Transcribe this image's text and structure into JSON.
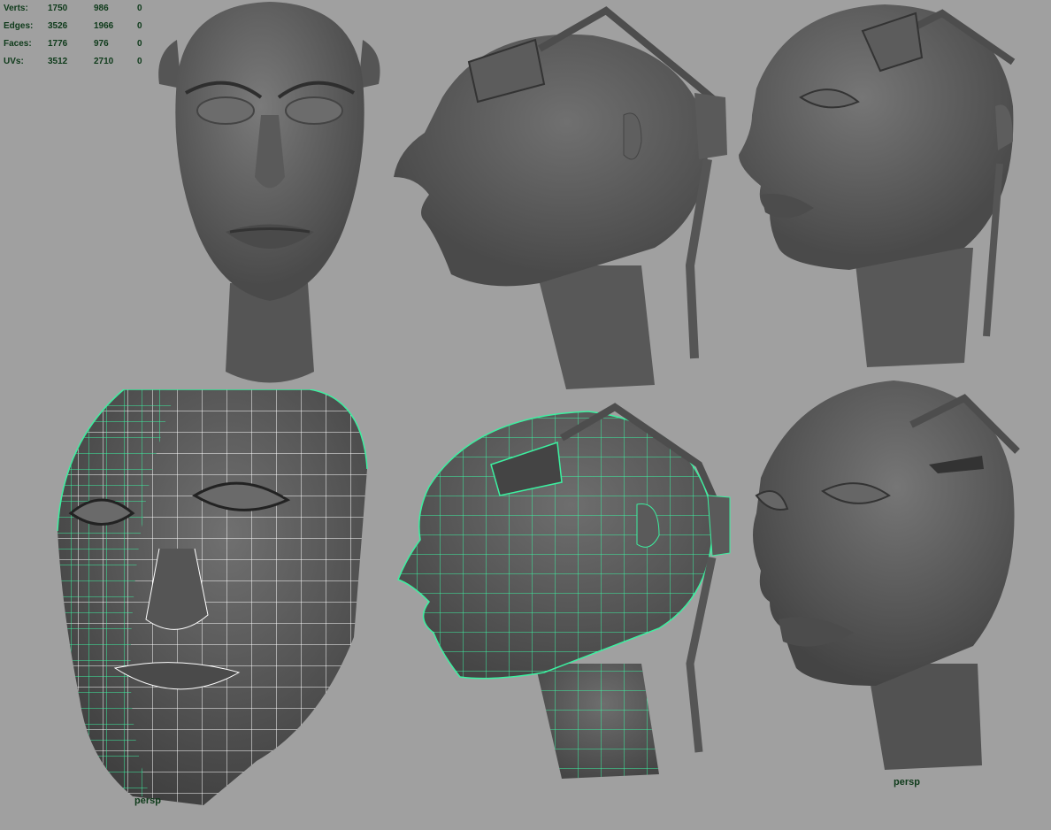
{
  "hud": {
    "rows": [
      {
        "label": "Verts:",
        "v1": "1750",
        "v2": "986",
        "v3": "0"
      },
      {
        "label": "Edges:",
        "v1": "3526",
        "v2": "1966",
        "v3": "0"
      },
      {
        "label": "Faces:",
        "v1": "1776",
        "v2": "976",
        "v3": "0"
      },
      {
        "label": "UVs:",
        "v1": "3512",
        "v2": "2710",
        "v3": "0"
      }
    ]
  },
  "cameras": {
    "left": "persp",
    "right": "persp"
  },
  "colors": {
    "background": "#a0a0a0",
    "mesh": "#5e5e5e",
    "mesh_dark": "#3c3c3c",
    "wireframe_selected": "#3cf0a0",
    "wireframe_white": "#ffffff",
    "hud_text": "#0e3a1a"
  }
}
